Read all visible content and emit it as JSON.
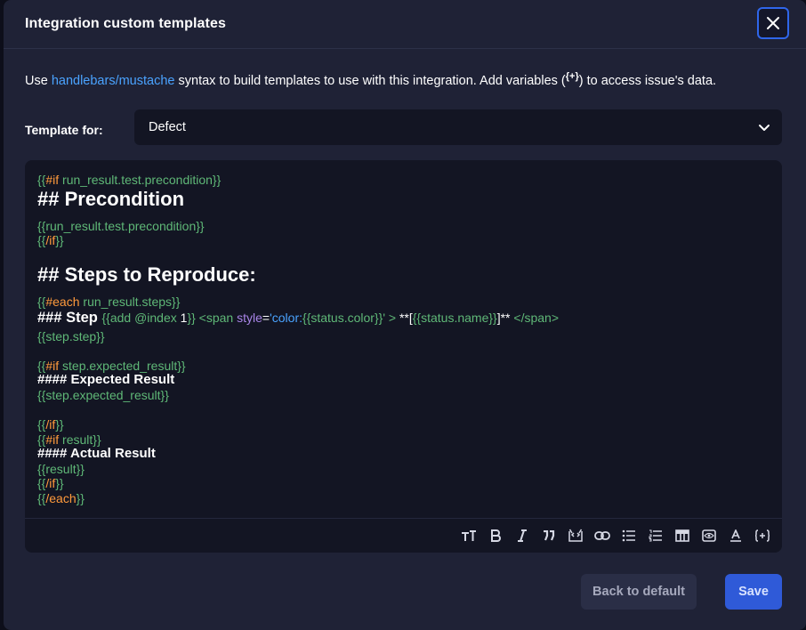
{
  "dialog": {
    "title": "Integration custom templates"
  },
  "intro": {
    "prefix": "Use ",
    "link": "handlebars/mustache",
    "middle": " syntax to build templates to use with this integration. Add variables (",
    "var_icon": "{+}",
    "suffix": ") to access issue's data."
  },
  "template_for": {
    "label": "Template for:",
    "selected": "Defect"
  },
  "editor": {
    "lines": {
      "l1a": "{{",
      "l1b": "#if",
      "l1c": " run_result.test.precondition}}",
      "l2": "## Precondition",
      "l3": "{{run_result.test.precondition}}",
      "l4a": "{{",
      "l4b": "/if",
      "l4c": "}}",
      "l5": "## Steps to Reproduce:",
      "l6a": "{{",
      "l6b": "#each",
      "l6c": " run_result.steps}}",
      "l7a": "### Step ",
      "l7b": "{{add @index ",
      "l7c": "1",
      "l7d": "}} <span ",
      "l7e": "style",
      "l7f": "=",
      "l7g": "'color:",
      "l7h": "{{status.color}}",
      "l7i": "' >",
      "l7j": " **[",
      "l7k": "{{status.name}}",
      "l7l": "]** ",
      "l7m": "</span>",
      "l8": "{{step.step}}",
      "l9a": "{{",
      "l9b": "#if",
      "l9c": " step.expected_result}}",
      "l10": "#### Expected Result",
      "l11": "{{step.expected_result}}",
      "l12a": "{{",
      "l12b": "/if",
      "l12c": "}}",
      "l13a": "{{",
      "l13b": "#if",
      "l13c": " result}}",
      "l14": "#### Actual Result",
      "l15": "{{result}}",
      "l16a": "{{",
      "l16b": "/if",
      "l16c": "}}",
      "l17a": "{{",
      "l17b": "/each",
      "l17c": "}}"
    },
    "toolbar": [
      "text-size-icon",
      "bold-icon",
      "italic-icon",
      "quote-icon",
      "code-icon",
      "link-icon",
      "bullet-list-icon",
      "numbered-list-icon",
      "table-icon",
      "preview-icon",
      "text-color-icon",
      "variable-icon"
    ]
  },
  "actions": {
    "back_to_default": "Back to default",
    "save": "Save"
  },
  "colors": {
    "accent": "#2f66ea",
    "link": "#4aa3ff",
    "handlebars": "#5fb877",
    "keyword": "#ff9a3c"
  }
}
